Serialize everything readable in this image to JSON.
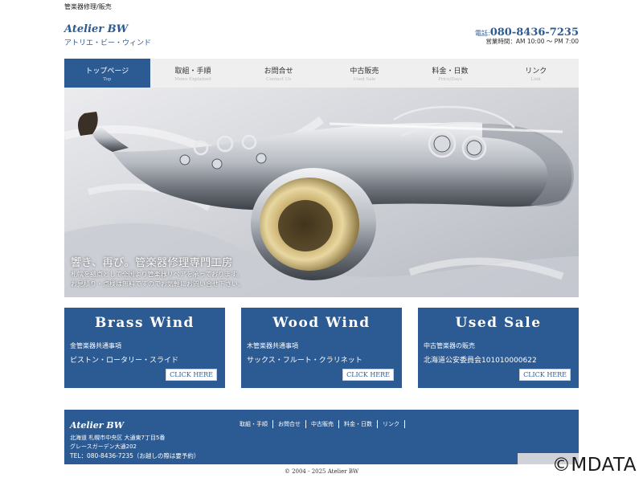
{
  "header": {
    "topline": "管楽器修理/販売",
    "brand_title": "Atelier BW",
    "brand_sub": "アトリエ・ビー・ウィンド",
    "phone_label": "電話:",
    "phone": "080-8436-7235",
    "hours": "営業時間：AM 10:00 ～ PM 7:00"
  },
  "nav": {
    "items": [
      {
        "jp": "トップページ",
        "en": "Top"
      },
      {
        "jp": "取組・手順",
        "en": "Menu Explained"
      },
      {
        "jp": "お問合せ",
        "en": "Contact Us"
      },
      {
        "jp": "中古販売",
        "en": "Used Sale"
      },
      {
        "jp": "料金・日数",
        "en": "Price/Days"
      },
      {
        "jp": "リンク",
        "en": "Link"
      }
    ]
  },
  "hero": {
    "headline": "響き、再び。管楽器修理専門工房",
    "line1": "札幌を拠点として全国より管楽器リペアを承っております。",
    "line2": "お見積り・点検は無料ですのでお気軽にお問い合せ下さい。"
  },
  "cards": [
    {
      "title": "Brass Wind",
      "line1": "金管楽器共通事項",
      "line2": "ピストン・ロータリー・スライド",
      "button": "CLICK HERE"
    },
    {
      "title": "Wood Wind",
      "line1": "木管楽器共通事項",
      "line2": "サックス・フルート・クラリネット",
      "button": "CLICK HERE"
    },
    {
      "title": "Used Sale",
      "line1": "中古管楽器の販売",
      "line2": "北海道公安委員会101010000622",
      "button": "CLICK HERE"
    }
  ],
  "footer": {
    "title": "Atelier BW",
    "address1": "北海道 札幌市中央区 大通東7丁目5番",
    "address2": "グレースガーデン大通202",
    "tel": "TEL：080-8436-7235（お越しの際は要予約）",
    "nav": [
      "取組・手順",
      "お問合せ",
      "中古販売",
      "料金・日数",
      "リンク"
    ]
  },
  "copyright": "© 2004 - 2025 Atelier BW",
  "watermark": "©MDATA",
  "colors": {
    "brand": "#2c5b94",
    "nav_bg": "#efefef"
  }
}
